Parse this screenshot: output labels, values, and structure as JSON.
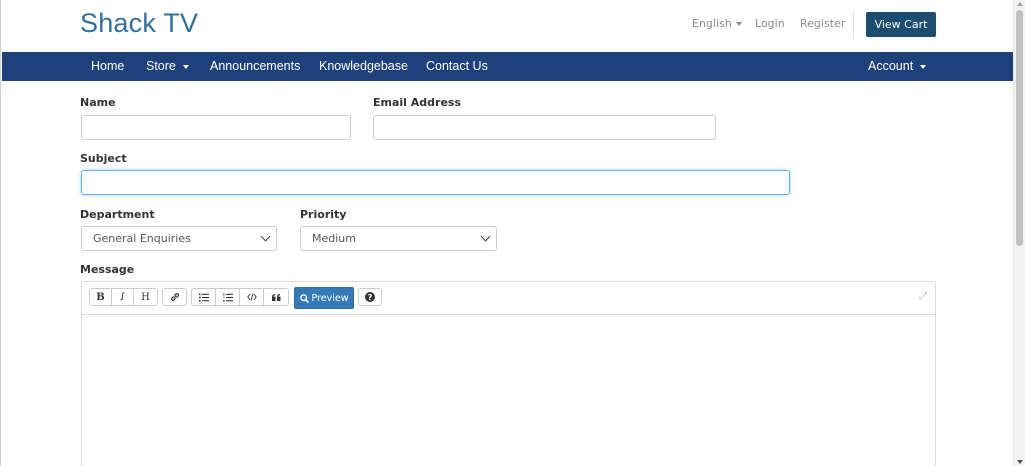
{
  "header": {
    "logo": "Shack TV",
    "language": "English",
    "login": "Login",
    "register": "Register",
    "view_cart": "View Cart"
  },
  "nav": {
    "home": "Home",
    "store": "Store",
    "announcements": "Announcements",
    "knowledgebase": "Knowledgebase",
    "contact": "Contact Us",
    "account": "Account"
  },
  "form": {
    "name_label": "Name",
    "name_value": "",
    "email_label": "Email Address",
    "email_value": "",
    "subject_label": "Subject",
    "subject_value": "",
    "department_label": "Department",
    "department_value": "General Enquiries",
    "priority_label": "Priority",
    "priority_value": "Medium",
    "message_label": "Message"
  },
  "editor": {
    "bold": "B",
    "italic": "I",
    "heading": "H",
    "preview": "Preview",
    "help": "?"
  },
  "colors": {
    "brand": "#31709d",
    "nav_bg": "#1f417b",
    "view_cart_bg": "#1d4d6e",
    "preview_bg": "#337ab7",
    "focus": "#66afe9"
  },
  "icons": [
    "caret-down-icon",
    "bold-icon",
    "italic-icon",
    "heading-icon",
    "link-icon",
    "unordered-list-icon",
    "ordered-list-icon",
    "code-icon",
    "quote-icon",
    "search-icon",
    "help-icon",
    "expand-icon",
    "chevron-down-icon"
  ]
}
